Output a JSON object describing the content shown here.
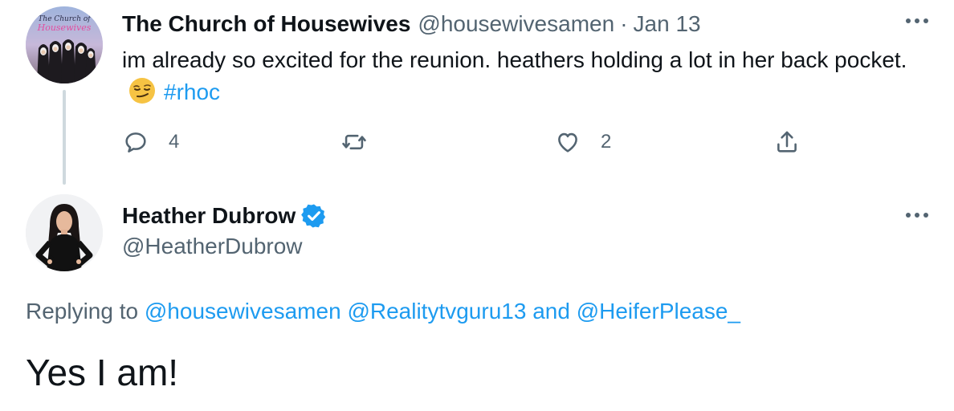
{
  "tweet1": {
    "display_name": "The Church of Housewives",
    "handle": "@housewivesamen",
    "separator": "·",
    "date": "Jan 13",
    "text": "im already so excited for the reunion. heathers holding a lot in her back pocket.",
    "emoji": "smirking-face-emoji",
    "hashtag": "#rhoc",
    "avatar_caption": "The Church of Housewives",
    "actions": {
      "reply_count": "4",
      "retweet_count": "",
      "like_count": "2"
    }
  },
  "tweet2": {
    "display_name": "Heather Dubrow",
    "verified": true,
    "handle": "@HeatherDubrow",
    "replying_prefix": "Replying to",
    "mentions": [
      "@housewivesamen",
      "@Realitytvguru13",
      "@HeiferPlease_"
    ],
    "conjunction": "and",
    "text": "Yes I am!"
  },
  "more_glyph": "•••",
  "colors": {
    "link": "#1d9bf0",
    "secondary_text": "#536471",
    "primary_text": "#0f1419",
    "thread_line": "#cfd9de"
  },
  "icons": [
    "reply-icon",
    "retweet-icon",
    "like-icon",
    "share-icon",
    "verified-badge-icon",
    "more-icon"
  ]
}
